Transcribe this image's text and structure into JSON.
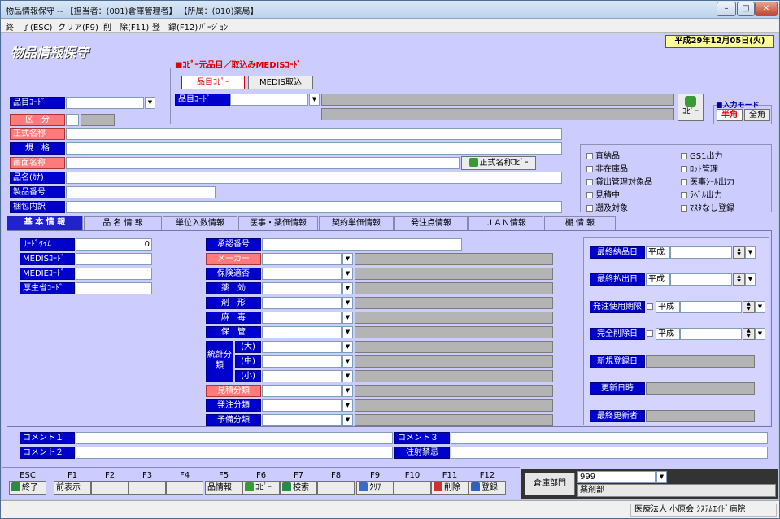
{
  "window": {
    "title": "物品情報保守 -- 【担当者：(001)倉庫管理者】 【所属：(010)薬局】"
  },
  "menu": [
    "終　了(ESC)",
    "クリア(F9)",
    "削　除(F11)",
    "登　録(F12)",
    "ﾊﾞｰｼﾞｮﾝ"
  ],
  "header": {
    "date": "平成29年12月05日(火)",
    "app_title": "物品情報保守"
  },
  "copy_section": {
    "heading": "■ｺﾋﾟｰ元品目／取込みMEDISｺｰﾄﾞ",
    "tab_hinmoku": "品目ｺﾋﾟｰ",
    "tab_medis": "MEDIS取込",
    "item_code_label": "品目ｺｰﾄﾞ",
    "copy_button": "ｺﾋﾟｰ"
  },
  "input_mode": {
    "label": "■入力モード",
    "hankaku": "半角",
    "zenkaku": "全角"
  },
  "main_fields": {
    "item_code": "品目ｺｰﾄﾞ",
    "kubun": "区　分",
    "official_name": "正式名称",
    "spec": "規　格",
    "screen_name": "画面名称",
    "copy_official": "正式名称ｺﾋﾟｰ",
    "kana_name": "品名(ｶﾅ)",
    "product_no": "製品番号",
    "package": "梱包内訳"
  },
  "checkboxes_left": [
    "直納品",
    "非在庫品",
    "貸出管理対象品",
    "見積中",
    "遡及対象"
  ],
  "checkboxes_right": [
    "GS1出力",
    "ﾛｯﾄ管理",
    "医事ｼｰﾙ出力",
    "ﾗﾍﾞﾙ出力",
    "ﾏｽﾀなし登録"
  ],
  "tabs": [
    "基 本 情 報",
    "品 名 情 報",
    "単位入数情報",
    "医事・薬価情報",
    "契約単価情報",
    "発注点情報",
    "ＪＡＮ情報",
    "棚 情 報"
  ],
  "basic": {
    "lead_time": "ﾘｰﾄﾞﾀｲﾑ",
    "lead_time_value": "0",
    "medis": "MEDISｺｰﾄﾞ",
    "medie": "MEDIEｺｰﾄﾞ",
    "mhlw": "厚生省ｺｰﾄﾞ"
  },
  "mid": {
    "approval": "承認番号",
    "maker": "メーカー",
    "insurance": "保険適否",
    "efficacy": "薬　効",
    "form": "剤　形",
    "narcotic": "麻　毒",
    "storage": "保　管",
    "stat_class": "統計分類",
    "stat_large": "(大)",
    "stat_mid": "(中)",
    "stat_small": "(小)",
    "estimate_class": "見積分類",
    "order_class": "発注分類",
    "reserve_class": "予備分類"
  },
  "dates": {
    "last_delivery": "最終納品日",
    "last_payment": "最終払出日",
    "order_expiry": "発注使用期限",
    "full_delete": "完全削除日",
    "new_reg": "新規登録日",
    "updated": "更新日時",
    "last_updater": "最終更新者",
    "era": "平成"
  },
  "comments": {
    "c1": "コメント１",
    "c2": "コメント２",
    "c3": "コメント３",
    "injection": "注射禁忌"
  },
  "fkeys": {
    "labels": [
      "ESC",
      "F1",
      "F2",
      "F3",
      "F4",
      "F5",
      "F6",
      "F7",
      "F8",
      "F9",
      "F10",
      "F11",
      "F12"
    ],
    "buttons": [
      "終了",
      "前表示",
      "",
      "",
      "",
      "品情報",
      "ｺﾋﾟｰ",
      "検索",
      "",
      "ｸﾘｱ",
      "",
      "削除",
      "登録"
    ]
  },
  "dept": {
    "label": "倉庫部門",
    "code": "999",
    "name": "薬剤部"
  },
  "status": {
    "hospital": "医療法人 小原会 ｼｽﾃﾑｴｲﾄﾞ病院"
  }
}
